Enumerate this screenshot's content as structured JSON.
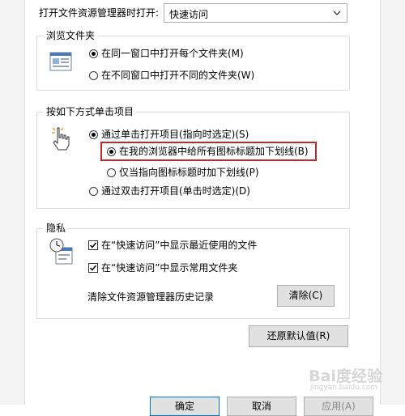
{
  "open_in": {
    "label": "打开文件资源管理器时打开:",
    "value": "快速访问"
  },
  "browse": {
    "title": "浏览文件夹",
    "options": [
      "在同一窗口中打开每个文件夹(M)",
      "在不同窗口中打开不同的文件夹(W)"
    ]
  },
  "click": {
    "title": "按如下方式单击项目",
    "single": "通过单击打开项目(指向时选定)(S)",
    "underline_all": "在我的浏览器中给所有图标标题加下划线(B)",
    "underline_hover": "仅当指向图标标题时加下划线(P)",
    "double": "通过双击打开项目(单击时选定)(D)"
  },
  "privacy": {
    "title": "隐私",
    "recent": "在“快速访问”中显示最近使用的文件",
    "frequent": "在“快速访问”中显示常用文件夹",
    "clear_history": "清除文件资源管理器历史记录",
    "clear_button": "清除(C)"
  },
  "restore_button": "还原默认值(R)",
  "footer": {
    "ok": "确定",
    "cancel": "取消",
    "apply": "应用(A)"
  },
  "watermark": {
    "main": "Bai度经验",
    "sub": "jingyan.baidu.com"
  },
  "colors": {
    "highlight": "#c0282b",
    "button_bg": "#e1e1e1"
  }
}
